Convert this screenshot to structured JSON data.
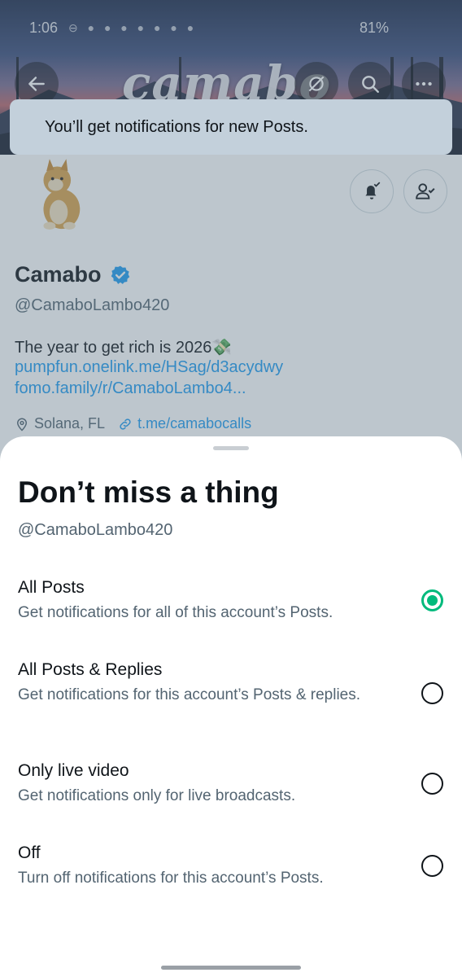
{
  "status_bar": {
    "time": "1:06",
    "battery": "81%"
  },
  "banner": {
    "logo_text": "camabo"
  },
  "toast": {
    "message": "You’ll get notifications for new Posts."
  },
  "profile": {
    "display_name": "Camabo",
    "handle": "@CamaboLambo420",
    "bio": "The year to get rich is 2026💸",
    "links": [
      "pumpfun.onelink.me/HSag/d3acydwy",
      "fomo.family/r/CamaboLambo4..."
    ],
    "location": "Solana, FL",
    "website": "t.me/camabocalls"
  },
  "sheet": {
    "title": "Don’t miss a thing",
    "handle": "@CamaboLambo420",
    "options": [
      {
        "label": "All Posts",
        "description": "Get notifications for all of this account’s Posts.",
        "selected": true
      },
      {
        "label": "All Posts & Replies",
        "description": "Get notifications for this account’s Posts & replies.",
        "selected": false
      },
      {
        "label": "Only live video",
        "description": "Get notifications only for live broadcasts.",
        "selected": false
      },
      {
        "label": "Off",
        "description": "Turn off notifications for this account’s Posts.",
        "selected": false
      }
    ]
  },
  "colors": {
    "accent_green": "#00ba7c",
    "link_blue": "#1d9bf0",
    "verified_blue": "#1d9bf0"
  }
}
